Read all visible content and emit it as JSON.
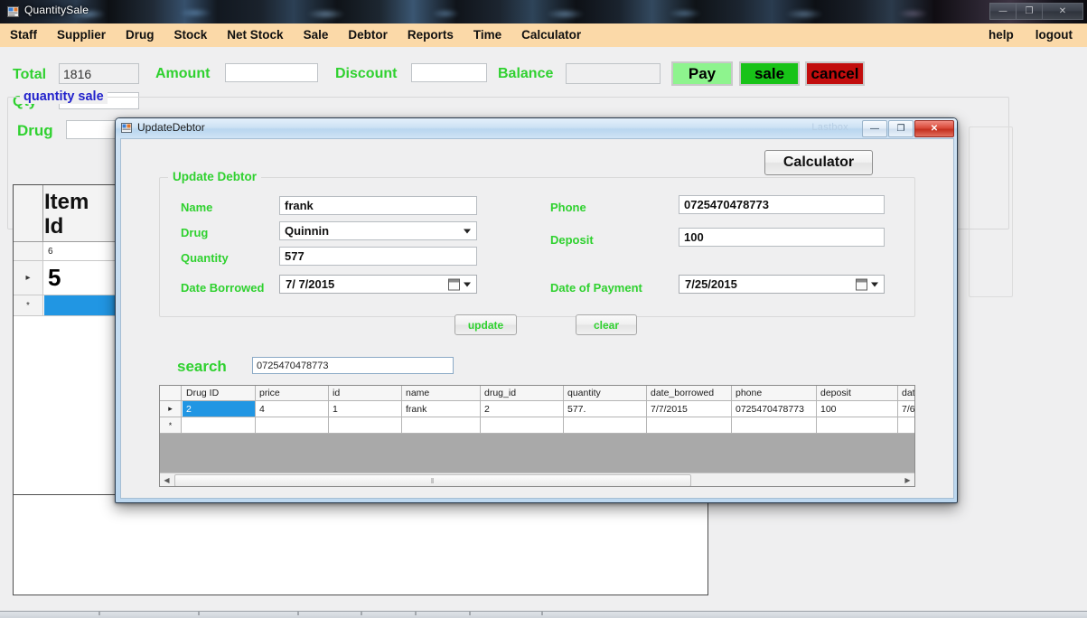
{
  "window": {
    "title": "QuantitySale",
    "icon": "app-icon",
    "controls": {
      "minimize": "—",
      "maximize": "❐",
      "close": "✕"
    }
  },
  "menu": {
    "items": [
      "Staff",
      "Supplier",
      "Drug",
      "Stock",
      "Net Stock",
      "Sale",
      "Debtor",
      "Reports",
      "Time",
      "Calculator"
    ],
    "right_items": [
      "help",
      "logout"
    ]
  },
  "toolbar": {
    "total_label": "Total",
    "total_value": "1816",
    "amount_label": "Amount",
    "amount_value": "",
    "discount_label": "Discount",
    "discount_value": "",
    "balance_label": "Balance",
    "balance_value": "",
    "pay_label": "Pay",
    "sale_label": "sale",
    "cancel_label": "cancel",
    "qty_label": "Qty",
    "qty_value": "",
    "group_legend": "quantity sale",
    "drug_label": "Drug",
    "drug_value": ""
  },
  "background_grid": {
    "header": "Item\nId",
    "header_line1": "Item",
    "header_line2": "Id",
    "rows": [
      {
        "marker": "",
        "value": "6"
      },
      {
        "marker": "▸",
        "value": "5"
      },
      {
        "marker": "*",
        "value": ""
      }
    ]
  },
  "dialog": {
    "title": "UpdateDebtor",
    "ghost_title": "Lastbox",
    "icon": "form-icon",
    "controls": {
      "minimize": "—",
      "maximize": "❐",
      "close": "✕"
    },
    "calculator_button": "Calculator",
    "group_legend": "Update Debtor",
    "fields": {
      "name_label": "Name",
      "name_value": "frank",
      "drug_label": "Drug",
      "drug_value": "Quinnin",
      "quantity_label": "Quantity",
      "quantity_value": "577",
      "date_borrowed_label": "Date Borrowed",
      "date_borrowed_value": "7/  7/2015",
      "phone_label": "Phone",
      "phone_value": "0725470478773",
      "deposit_label": "Deposit",
      "deposit_value": "100",
      "date_of_payment_label": "Date of Payment",
      "date_of_payment_value": "7/25/2015"
    },
    "update_button": "update",
    "clear_button": "clear",
    "search_label": "search",
    "search_value": "0725470478773",
    "grid": {
      "columns": [
        "Drug ID",
        "price",
        "id",
        "name",
        "drug_id",
        "quantity",
        "date_borrowed",
        "phone",
        "deposit",
        "dat"
      ],
      "rows": [
        {
          "marker": "▸",
          "cells": [
            "2",
            "4",
            "1",
            "frank",
            "2",
            "577.",
            "7/7/2015",
            "0725470478773",
            "100",
            "7/6"
          ]
        },
        {
          "marker": "*",
          "cells": [
            "",
            "",
            "",
            "",
            "",
            "",
            "",
            "",
            "",
            ""
          ]
        }
      ],
      "scroll_thumb_grip": "‖"
    }
  },
  "colors": {
    "menu_bg": "#fbd9a8",
    "label_green": "#2fd12f",
    "legend_blue": "#2222cc",
    "pay_green": "#8ef48e",
    "sale_green": "#18c318",
    "cancel_red": "#c20d0d",
    "selection_blue": "#2196e3",
    "form_bg": "#efeff0"
  }
}
